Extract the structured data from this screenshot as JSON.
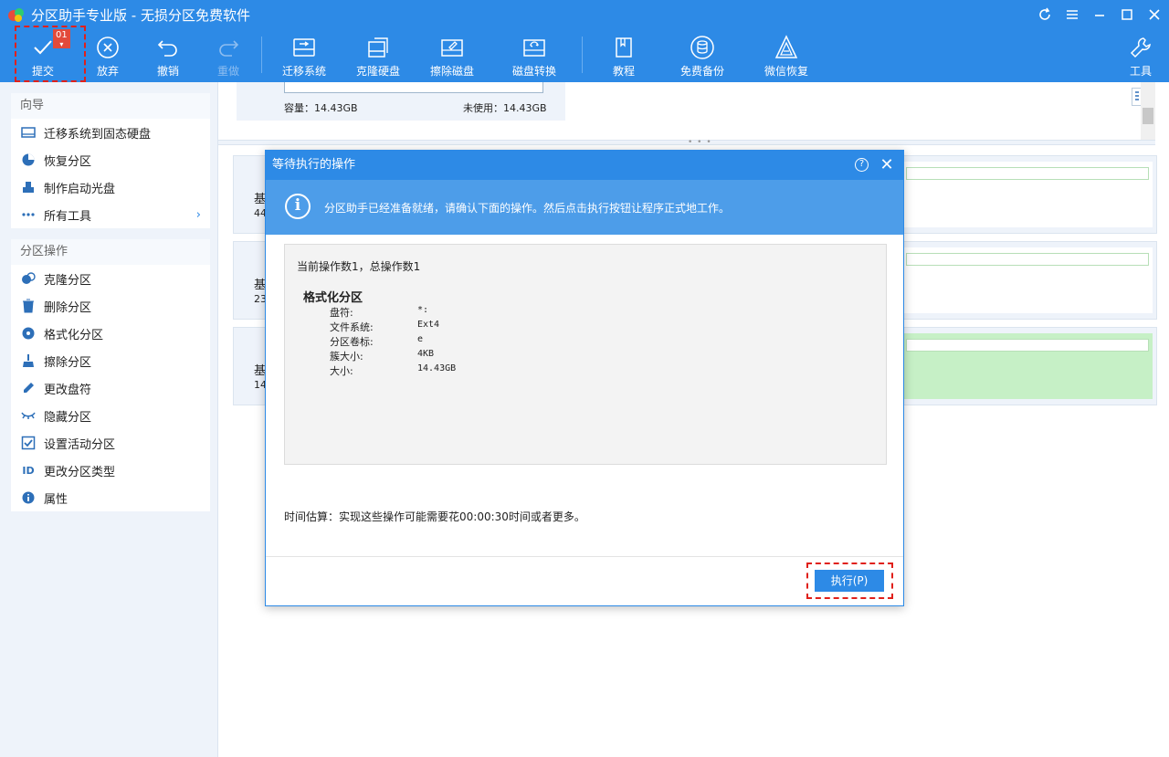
{
  "window": {
    "title": "分区助手专业版 - 无损分区免费软件",
    "controls": [
      "refresh-icon",
      "menu-icon",
      "minimize-icon",
      "maximize-icon",
      "close-icon"
    ]
  },
  "toolbar": {
    "commit": {
      "label": "提交",
      "badge": "01"
    },
    "discard": "放弃",
    "undo": "撤销",
    "redo": "重做",
    "migrate": "迁移系统",
    "clone": "克隆硬盘",
    "wipe": "擦除磁盘",
    "convert": "磁盘转换",
    "tutorial": "教程",
    "backup": "免费备份",
    "wechat": "微信恢复",
    "tools": "工具"
  },
  "sidebar": {
    "wizard": {
      "title": "向导",
      "items": [
        "迁移系统到固态硬盘",
        "恢复分区",
        "制作启动光盘",
        "所有工具"
      ]
    },
    "partition_ops": {
      "title": "分区操作",
      "items": [
        "克隆分区",
        "删除分区",
        "格式化分区",
        "擦除分区",
        "更改盘符",
        "隐藏分区",
        "设置活动分区",
        "更改分区类型",
        "属性"
      ]
    }
  },
  "top_disk": {
    "capacity": "容量：14.43GB",
    "unused": "未使用：14.43GB"
  },
  "disks": [
    {
      "label": "基",
      "size": "44"
    },
    {
      "label": "基",
      "size": "23"
    },
    {
      "label": "基",
      "size": "14"
    }
  ],
  "dialog": {
    "title": "等待执行的操作",
    "banner": "分区助手已经准备就绪，请确认下面的操作。然后点击执行按钮让程序正式地工作。",
    "count": "当前操作数1，总操作数1",
    "op_title": "格式化分区",
    "details": [
      {
        "k": "盘符:",
        "v": "*:"
      },
      {
        "k": "文件系统:",
        "v": "Ext4"
      },
      {
        "k": "分区卷标:",
        "v": "e"
      },
      {
        "k": "簇大小:",
        "v": "4KB"
      },
      {
        "k": "大小:",
        "v": "14.43GB"
      }
    ],
    "estimate": "时间估算：实现这些操作可能需要花00:00:30时间或者更多。",
    "execute": "执行(P)"
  }
}
